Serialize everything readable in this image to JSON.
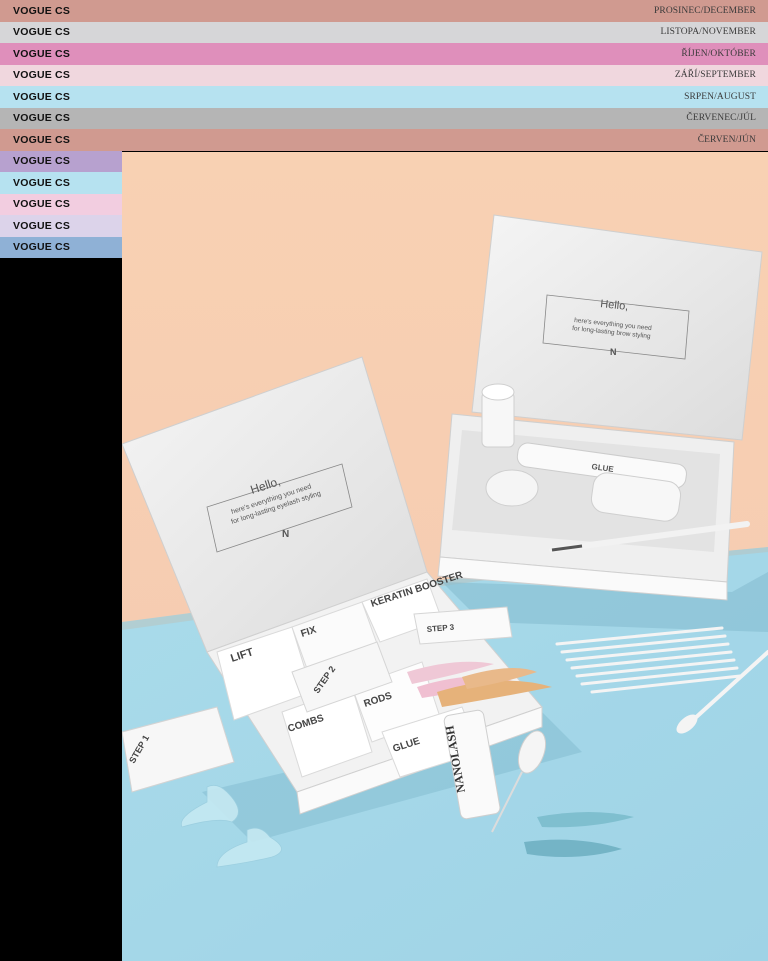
{
  "issues": [
    {
      "brand": "VOGUE CS",
      "month": "PROSINEC/DECEMBER",
      "color": "#d09a90"
    },
    {
      "brand": "VOGUE CS",
      "month": "LISTOPA/NOVEMBER",
      "color": "#d6d6d8"
    },
    {
      "brand": "VOGUE CS",
      "month": "ŘÍJEN/OKTÓBER",
      "color": "#df8fbb"
    },
    {
      "brand": "VOGUE CS",
      "month": "ZÁŘÍ/SEPTEMBER",
      "color": "#f0d7de"
    },
    {
      "brand": "VOGUE CS",
      "month": "SRPEN/AUGUST",
      "color": "#b6e2f0"
    },
    {
      "brand": "VOGUE CS",
      "month": "ČERVENEC/JÚL",
      "color": "#b5b5b5"
    },
    {
      "brand": "VOGUE CS",
      "month": "ČERVEN/JÚN",
      "color": "#d09a90"
    },
    {
      "brand": "VOGUE CS",
      "color": "#b7a1cf"
    },
    {
      "brand": "VOGUE CS",
      "color": "#b6e2f0"
    },
    {
      "brand": "VOGUE CS",
      "color": "#f2cde0"
    },
    {
      "brand": "VOGUE CS",
      "color": "#dcd3ea"
    },
    {
      "brand": "VOGUE CS",
      "color": "#8fb1d6"
    }
  ],
  "photo": {
    "lash_box": {
      "lid_hello": "Hello,",
      "lid_line1": "here's everything you need",
      "lid_line2": "for long-lasting eyelash styling",
      "logo": "N",
      "packets": {
        "lift": "LIFT",
        "fix": "FIX",
        "keratin_booster": "KERATIN BOOSTER",
        "combs": "COMBS",
        "rods": "RODS",
        "glue": "GLUE"
      },
      "step1": "STEP 1",
      "step2": "STEP 2",
      "step3": "STEP 3"
    },
    "brow_box": {
      "lid_hello": "Hello,",
      "lid_line1": "here's everything you need",
      "lid_line2": "for long-lasting brow styling",
      "logo": "N",
      "tube_label": "GLUE"
    },
    "glue_bottle": "NANOLASH"
  }
}
